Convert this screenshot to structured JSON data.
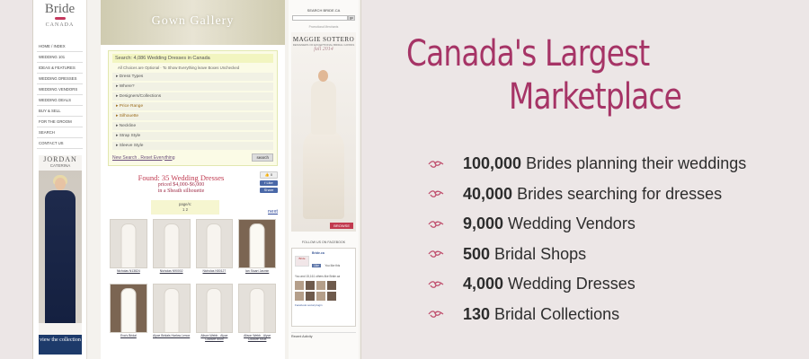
{
  "site": {
    "logo": {
      "line1": "Bride",
      "line2": "CANADA"
    },
    "nav": [
      "HOME / INDEX",
      "WEDDING 101",
      "IDEAS & FEATURES",
      "WEDDING DRESSES",
      "WEDDING VENDORS",
      "WEDDING DEALS",
      "BUY & SELL",
      "FOR THE GROOM",
      "SEARCH",
      "CONTACT US"
    ],
    "left_ad": {
      "brand": "JORDAN",
      "sub": "CATERINA",
      "cta": "view the collection"
    },
    "banner_title": "Gown Gallery",
    "search": {
      "heading": "Search: 4,086 Wedding Dresses in Canada",
      "note": "All Choices are Optional · To Show Everything leave Boxes Unchecked",
      "filters": [
        "Dress Types",
        "Where?",
        "Designers/Collections",
        "Price Range",
        "Silhouette",
        "Neckline",
        "Strap Style",
        "Sleeve Style"
      ],
      "new_search": "New Search . Reset Everything",
      "button": "search"
    },
    "results": {
      "found": "Found: 35 Wedding Dresses",
      "priced": "priced $4,000-$6,000",
      "silhouette": "in a Sheath silhouette",
      "like_count": "0",
      "pages_label": "page/s:",
      "pages": "1  2",
      "next": "next",
      "thumbs": [
        "Nicholas N13824",
        "Nicholas N90002",
        "Nicholas N50127",
        "Ian Stuart Jasmin",
        "Eva's Bridal",
        "Alyce Bridals Harlow Lenox",
        "Alison Webb - Alyce Couture 5009",
        "Alison Webb - Alyce Couture 5008"
      ]
    },
    "right": {
      "search_label": "SEARCH BRIDE.CA",
      "go": "go",
      "promo_note": "Promotional Merchants",
      "ad_brand": "MAGGIE SOTTERO",
      "ad_tag": "DESIGNERS OF EXCEPTIONAL BRIDAL GOWNS",
      "ad_season": "fall 2014",
      "ad_button": "BROWSE",
      "fb_title": "FOLLOW US ON FACEBOOK",
      "fb_name": "Bride.ca",
      "fb_like": "Like",
      "fb_like_text": "You like this",
      "fb_fans": "You and 15,161 others like Bride.ca",
      "fb_plugin": "Facebook social plugin",
      "recent": "Recent Activity"
    }
  },
  "marketing": {
    "headline_line1": "Canada's Largest",
    "headline_line2": "Marketplace",
    "accent_color": "#a63466",
    "bullet_icon": "flourish-icon",
    "stats": [
      {
        "num": "100,000",
        "label": "Brides planning their weddings"
      },
      {
        "num": "40,000",
        "label": "Brides searching for dresses"
      },
      {
        "num": "9,000",
        "label": "Wedding Vendors"
      },
      {
        "num": "500",
        "label": "Bridal Shops"
      },
      {
        "num": "4,000",
        "label": "Wedding Dresses"
      },
      {
        "num": "130",
        "label": "Bridal Collections"
      }
    ]
  }
}
